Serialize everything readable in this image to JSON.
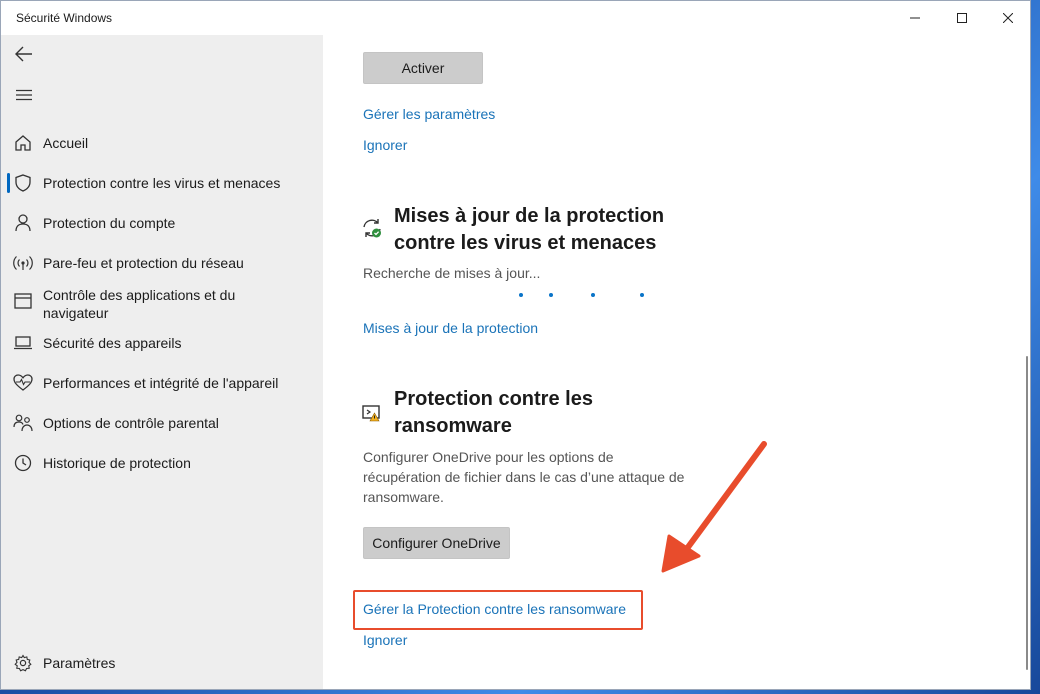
{
  "window": {
    "title": "Sécurité Windows"
  },
  "sidebar": {
    "items": [
      {
        "label": "Accueil",
        "icon": "home-icon"
      },
      {
        "label": "Protection contre les virus et menaces",
        "icon": "shield-icon",
        "active": true
      },
      {
        "label": "Protection du compte",
        "icon": "person-icon"
      },
      {
        "label": "Pare-feu et protection du réseau",
        "icon": "wifi-icon"
      },
      {
        "label": "Contrôle des applications et du navigateur",
        "icon": "browser-icon"
      },
      {
        "label": "Sécurité des appareils",
        "icon": "laptop-icon"
      },
      {
        "label": "Performances et intégrité de l'appareil",
        "icon": "heart-icon"
      },
      {
        "label": "Options de contrôle parental",
        "icon": "family-icon"
      },
      {
        "label": "Historique de protection",
        "icon": "history-icon"
      }
    ],
    "settings_label": "Paramètres"
  },
  "main": {
    "activate_button": "Activer",
    "manage_settings_link": "Gérer les paramètres",
    "ignore_link_1": "Ignorer",
    "updates": {
      "title": "Mises à jour de la protection contre les virus et menaces",
      "status": "Recherche de mises à jour...",
      "link": "Mises à jour de la protection"
    },
    "ransomware": {
      "title": "Protection contre les ransomware",
      "description": "Configurer OneDrive pour les options de récupération de fichier dans le cas d’une attaque de ransomware.",
      "configure_button": "Configurer OneDrive",
      "manage_link": "Gérer la Protection contre les ransomware",
      "ignore_link": "Ignorer"
    }
  },
  "colors": {
    "accent": "#0067c0",
    "link": "#1a73b8",
    "annotation": "#e84c2c"
  }
}
